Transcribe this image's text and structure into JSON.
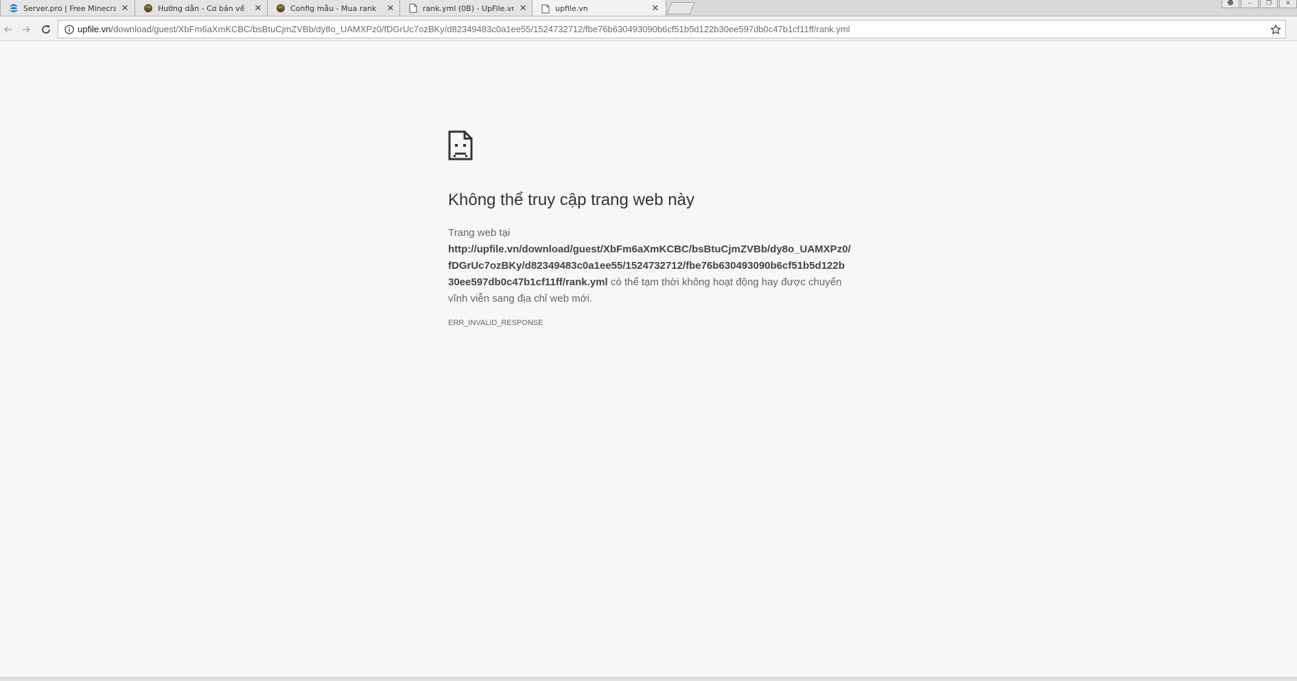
{
  "tabs": [
    {
      "title": "Server.pro | Free Minecra",
      "icon": "globe-icon"
    },
    {
      "title": "Hướng dẫn - Cơ bản về",
      "icon": "minecraft-block-icon"
    },
    {
      "title": "Config mẫu - Mua rank",
      "icon": "minecraft-block-icon"
    },
    {
      "title": "rank.yml (0B) - UpFile.vn",
      "icon": "page-icon"
    },
    {
      "title": "upfile.vn",
      "icon": "page-icon",
      "active": true
    }
  ],
  "omnibox": {
    "host": "upfile.vn",
    "path": "/download/guest/XbFm6aXmKCBC/bsBtuCjmZVBb/dy8o_UAMXPz0/fDGrUc7ozBKy/d82349483c0a1ee55/1524732712/fbe76b630493090b6cf51b5d122b30ee597db0c47b1cf11ff/rank.yml"
  },
  "error": {
    "heading": "Không thể truy cập trang web này",
    "intro": "Trang web tại",
    "url_line1": "http://upfile.vn/download/guest/XbFm6aXmKCBC/bsBtuCjmZVBb/dy8o_UAMXPz0/",
    "url_line2": "fDGrUc7ozBKy/d82349483c0a1ee55/1524732712/fbe76b630493090b6cf51b5d122b",
    "url_line3": "30ee597db0c47b1cf11ff/rank.yml",
    "suffix_line3": " có thể tạm thời không hoạt động hay được chuyển",
    "suffix_line4": "vĩnh viễn sang địa chỉ web mới.",
    "code": "ERR_INVALID_RESPONSE"
  },
  "colors": {
    "page_bg": "#f7f7f7",
    "heading": "#333333",
    "body_text": "#646464"
  }
}
